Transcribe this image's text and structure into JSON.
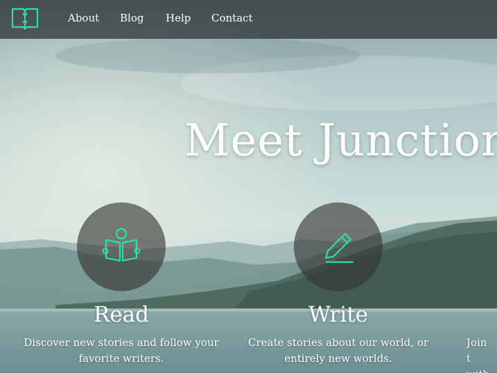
{
  "nav": {
    "logo_icon": "open-book-icon",
    "links": [
      "About",
      "Blog",
      "Help",
      "Contact"
    ]
  },
  "hero": {
    "title": "Meet Junction"
  },
  "features": [
    {
      "icon": "reader-icon",
      "title": "Read",
      "description": "Discover new stories and follow your favorite writers."
    },
    {
      "icon": "pencil-icon",
      "title": "Write",
      "description": "Create stories about our world, or entirely new worlds."
    },
    {
      "title": "",
      "description": "Join t with"
    }
  ],
  "colors": {
    "accent": "#2de0a7",
    "navbar": "#2c3032"
  }
}
